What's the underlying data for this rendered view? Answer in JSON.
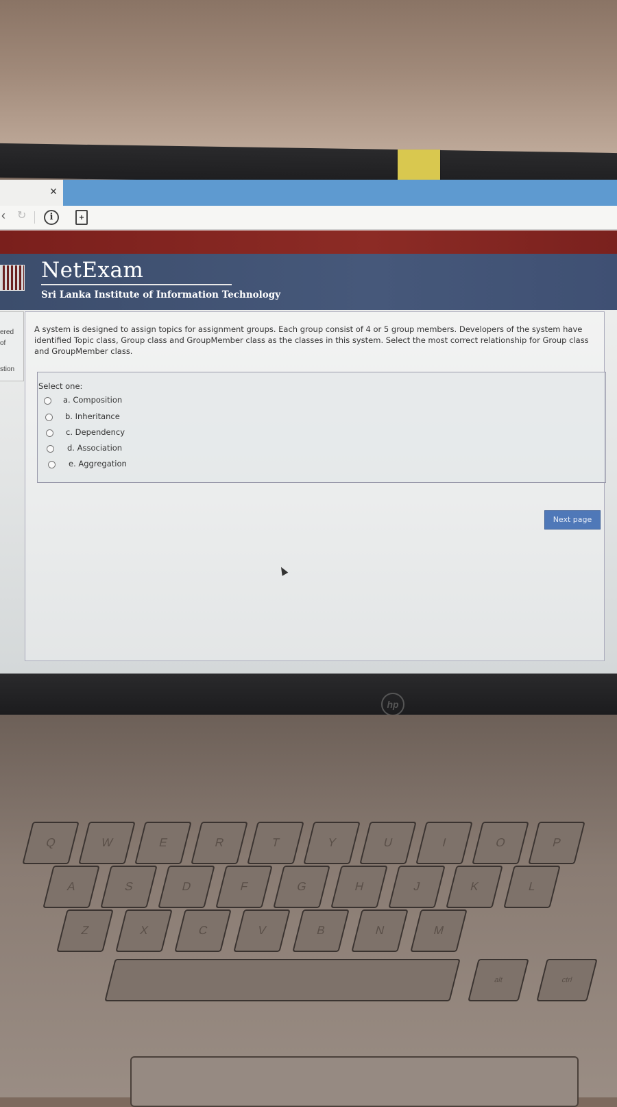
{
  "browser": {
    "tab_close": "×",
    "back_icon": "back-icon",
    "reload_icon": "reload-icon",
    "info_label": "i",
    "extension_icon": "extension-icon"
  },
  "header": {
    "brand": "NetExam",
    "institute": "Sri Lanka Institute of Information Technology"
  },
  "sidebar": {
    "lines": [
      "ered",
      "of",
      "stion"
    ]
  },
  "question": {
    "text": "A system is designed to assign topics for assignment groups. Each group consist of 4 or 5 group members. Developers of the system have identified Topic class, Group class and GroupMember class as the classes in this system. Select the most correct relationship for Group class and GroupMember class.",
    "prompt": "Select one:",
    "options": [
      {
        "label": "a. Composition"
      },
      {
        "label": "b. Inheritance"
      },
      {
        "label": "c. Dependency"
      },
      {
        "label": "d. Association"
      },
      {
        "label": "e. Aggregation"
      }
    ]
  },
  "actions": {
    "next_label": "Next page"
  },
  "laptop": {
    "logo": "hp",
    "keys": [
      "Q",
      "W",
      "E",
      "R",
      "T",
      "Y",
      "U",
      "I",
      "O",
      "P",
      "A",
      "S",
      "D",
      "F",
      "G",
      "H",
      "J",
      "K",
      "L",
      "Z",
      "X",
      "C",
      "V",
      "B",
      "N",
      "M",
      "alt",
      "ctrl"
    ]
  },
  "colors": {
    "header_bg": "#43557a",
    "red_band": "#842723",
    "tab_active": "#5e9ad0",
    "next_button": "#4f78b8"
  }
}
